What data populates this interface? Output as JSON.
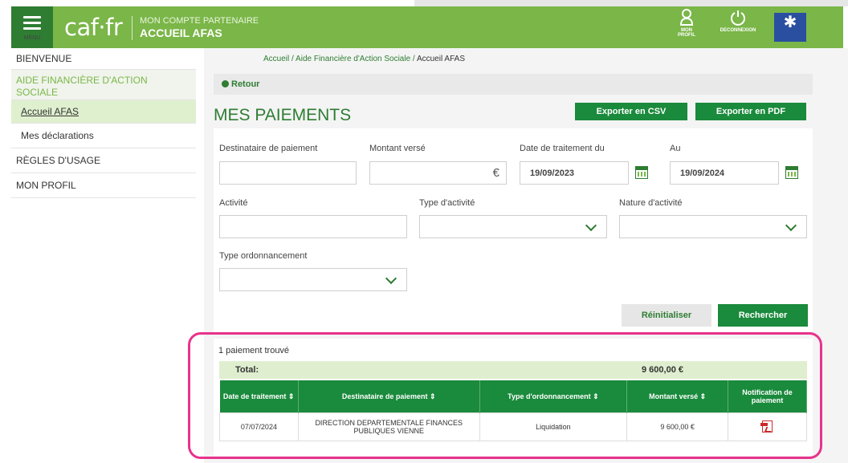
{
  "header": {
    "menu_label": "MENU",
    "logo": "caf·fr",
    "subtitle": "MON COMPTE PARTENAIRE",
    "title": "ACCUEIL AFAS",
    "profil_label_1": "MON",
    "profil_label_2": "PROFIL",
    "deconnexion_label": "DECONNEXION"
  },
  "sidebar": {
    "items": [
      {
        "label": "BIENVENUE"
      },
      {
        "label": "AIDE FINANCIÈRE D'ACTION SOCIALE"
      },
      {
        "label": "Accueil AFAS"
      },
      {
        "label": "Mes déclarations"
      },
      {
        "label": "RÈGLES D'USAGE"
      },
      {
        "label": "MON PROFIL"
      }
    ]
  },
  "breadcrumb": {
    "part1": "Accueil",
    "sep": " / ",
    "part2": "Aide Financière d'Action Sociale",
    "current": "Accueil AFAS"
  },
  "retour_label": "Retour",
  "page_title": "MES PAIEMENTS",
  "export": {
    "csv": "Exporter en CSV",
    "pdf": "Exporter en PDF"
  },
  "form": {
    "destinataire_label": "Destinataire de paiement",
    "montant_label": "Montant versé",
    "date_du_label": "Date de traitement du",
    "au_label": "Au",
    "date_du_value": "19/09/2023",
    "au_value": "19/09/2024",
    "euro": "€",
    "activite_label": "Activité",
    "type_activite_label": "Type d'activité",
    "nature_activite_label": "Nature d'activité",
    "type_ordonnancement_label": "Type ordonnancement",
    "reset_label": "Réinitialiser",
    "search_label": "Rechercher"
  },
  "results": {
    "count_text": "1 paiement trouvé",
    "total_label": "Total:",
    "total_value": "9 600,00 €",
    "columns": [
      "Date de traitement ⇕",
      "Destinataire de paiement ⇕",
      "Type d'ordonnancement ⇕",
      "Montant versé ⇕",
      "Notification de paiement"
    ],
    "rows": [
      {
        "date": "07/07/2024",
        "destinataire": "DIRECTION DEPARTEMENTALE FINANCES PUBLIQUES VIENNE",
        "type": "Liquidation",
        "montant": "9 600,00 €",
        "notification": "pdf-icon"
      }
    ]
  },
  "colors": {
    "brand_green": "#7ab648",
    "dark_green": "#1a8a3c",
    "highlight": "#e8338c"
  }
}
